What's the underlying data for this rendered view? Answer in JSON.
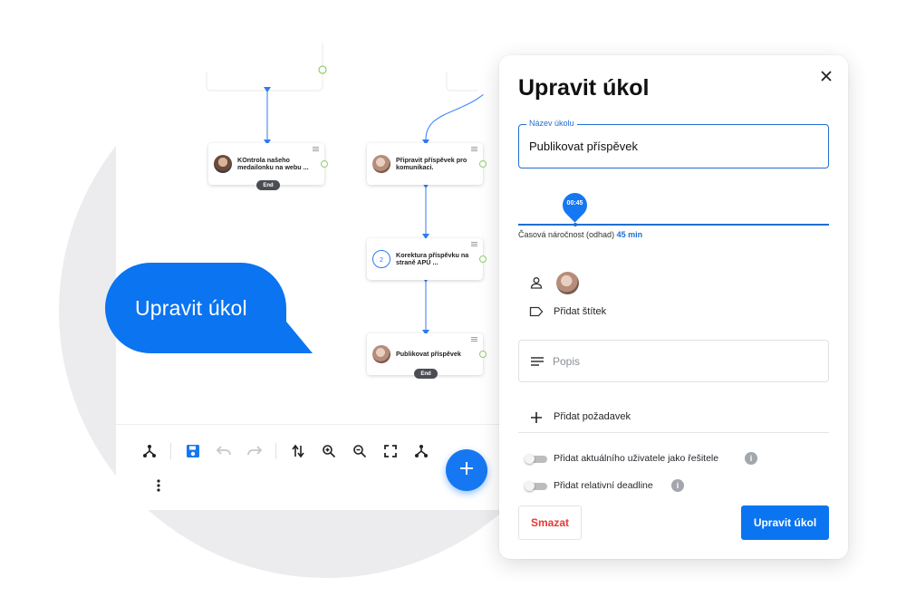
{
  "callout": {
    "text": "Upravit úkol"
  },
  "workflow": {
    "nodes": [
      {
        "label": "KOntrola našeho medailonku na webu ..."
      },
      {
        "label": "Připravit příspěvek pro komunikaci."
      },
      {
        "label": "Korektura příspěvku na straně APÚ ...",
        "badge": "2"
      },
      {
        "label": "Publikovat příspěvek"
      },
      {
        "label": "...",
        "badge": "2"
      }
    ],
    "end_label": "End",
    "toolbar_icons": [
      "hierarchy-icon",
      "save-icon",
      "undo-icon",
      "redo-icon",
      "swap-vertical-icon",
      "zoom-in-icon",
      "zoom-out-icon",
      "fullscreen-icon",
      "hierarchy-icon",
      "more-vertical-icon"
    ],
    "fab_icon": "plus-icon"
  },
  "modal": {
    "title": "Upravit úkol",
    "close_icon": "close-icon",
    "task_name": {
      "label": "Název úkolu",
      "value": "Publikovat příspěvek"
    },
    "slider": {
      "bubble": "00:45",
      "caption": "Časová náročnost (odhad)",
      "value": "45 min",
      "fraction": 0.19
    },
    "add_tag": "Přidat štítek",
    "description_placeholder": "Popis",
    "add_requirement": "Přidat požadavek",
    "toggles": [
      {
        "label": "Přidat aktuálního uživatele jako řešitele",
        "on": false
      },
      {
        "label": "Přidat relativní deadline",
        "on": false
      }
    ],
    "delete_button": "Smazat",
    "submit_button": "Upravit úkol"
  },
  "colors": {
    "accent": "#0b74f0",
    "danger": "#e53935",
    "port": "#8fce6f"
  }
}
